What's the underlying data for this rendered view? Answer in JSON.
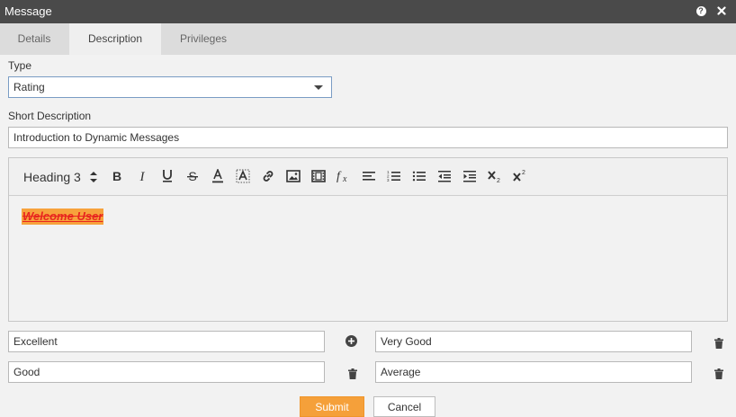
{
  "window": {
    "title": "Message"
  },
  "tabs": [
    {
      "label": "Details"
    },
    {
      "label": "Description"
    },
    {
      "label": "Privileges"
    }
  ],
  "active_tab": "Description",
  "type_field": {
    "label": "Type",
    "value": "Rating"
  },
  "short_description": {
    "label": "Short Description",
    "value": "Introduction to Dynamic Messages"
  },
  "editor": {
    "heading_select": "Heading 3",
    "toolbar_icons": [
      "bold-icon",
      "italic-icon",
      "underline-icon",
      "strikethrough-icon",
      "text-color-icon",
      "highlight-icon",
      "link-icon",
      "image-icon",
      "video-icon",
      "formula-icon",
      "align-icon",
      "ordered-list-icon",
      "unordered-list-icon",
      "outdent-icon",
      "indent-icon",
      "subscript-icon",
      "superscript-icon"
    ],
    "content": "Welcome User",
    "content_highlight_color": "#f7a23c",
    "content_text_color": "#e8261f"
  },
  "ratings": [
    {
      "value": "Excellent",
      "action_icon": "plus-circle-icon"
    },
    {
      "value": "Very Good",
      "action_icon": "trash-icon"
    },
    {
      "value": "Good",
      "action_icon": "trash-icon"
    },
    {
      "value": "Average",
      "action_icon": "trash-icon"
    }
  ],
  "buttons": {
    "submit": "Submit",
    "cancel": "Cancel"
  },
  "colors": {
    "titlebar": "#4a4a4a",
    "accent": "#f5a03a"
  }
}
